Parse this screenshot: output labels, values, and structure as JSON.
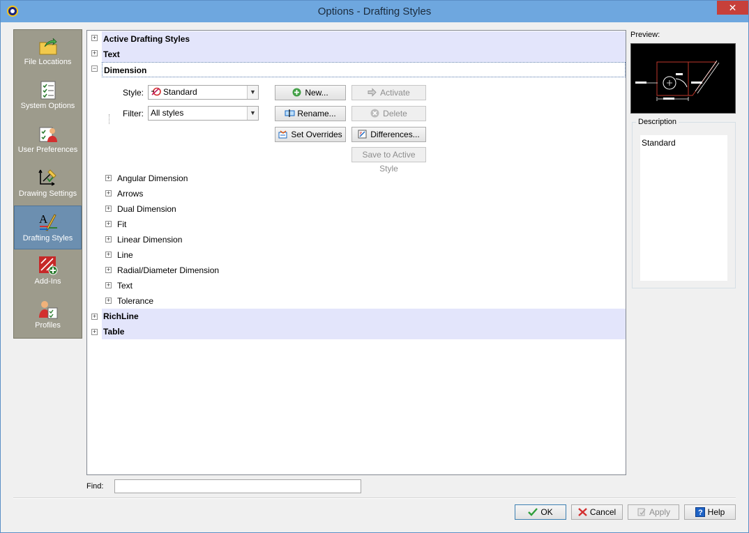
{
  "window": {
    "title": "Options - Drafting Styles",
    "close_label": "✕"
  },
  "nav": {
    "items": [
      {
        "label": "File Locations",
        "icon": "folder-arrow-icon",
        "active": false
      },
      {
        "label": "System Options",
        "icon": "checklist-icon",
        "active": false
      },
      {
        "label": "User Preferences",
        "icon": "user-preferences-icon",
        "active": false
      },
      {
        "label": "Drawing Settings",
        "icon": "drawing-settings-icon",
        "active": false
      },
      {
        "label": "Drafting Styles",
        "icon": "drafting-styles-icon",
        "active": true
      },
      {
        "label": "Add-Ins",
        "icon": "add-ins-icon",
        "active": false
      },
      {
        "label": "Profiles",
        "icon": "profiles-icon",
        "active": false
      }
    ]
  },
  "tree": {
    "categories": {
      "active_drafting_styles": "Active Drafting Styles",
      "text": "Text",
      "dimension": "Dimension",
      "richline": "RichLine",
      "table": "Table"
    },
    "style_label": "Style:",
    "style_value": "Standard",
    "filter_label": "Filter:",
    "filter_value": "All styles",
    "buttons": {
      "new": "New...",
      "activate": "Activate",
      "rename": "Rename...",
      "delete": "Delete",
      "set_overrides": "Set Overrides",
      "differences": "Differences...",
      "save_to_active": "Save to Active Style"
    },
    "sub_items": [
      "Angular Dimension",
      "Arrows",
      "Dual Dimension",
      "Fit",
      "Linear Dimension",
      "Line",
      "Radial/Diameter Dimension",
      "Text",
      "Tolerance"
    ]
  },
  "preview": {
    "label": "Preview:"
  },
  "description": {
    "title": "Description",
    "value": "Standard"
  },
  "find": {
    "label": "Find:",
    "value": ""
  },
  "dialog_buttons": {
    "ok": "OK",
    "cancel": "Cancel",
    "apply": "Apply",
    "help": "Help"
  },
  "colors": {
    "title_bar": "#6ea7df",
    "nav_bg": "#9d9b8c",
    "nav_active": "#6c8fb0",
    "category_bg": "#e3e5fb"
  }
}
